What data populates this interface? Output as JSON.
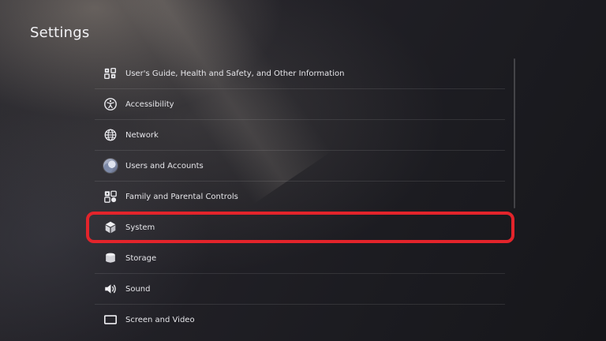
{
  "page": {
    "title": "Settings"
  },
  "settings": {
    "items": [
      {
        "label": "User's Guide, Health and Safety, and Other Information",
        "icon": "guide-icon"
      },
      {
        "label": "Accessibility",
        "icon": "accessibility-icon"
      },
      {
        "label": "Network",
        "icon": "globe-icon"
      },
      {
        "label": "Users and Accounts",
        "icon": "avatar"
      },
      {
        "label": "Family and Parental Controls",
        "icon": "family-icon"
      },
      {
        "label": "System",
        "icon": "cube-icon"
      },
      {
        "label": "Storage",
        "icon": "storage-icon"
      },
      {
        "label": "Sound",
        "icon": "speaker-icon"
      },
      {
        "label": "Screen and Video",
        "icon": "screen-icon"
      }
    ],
    "highlighted_index": 5
  },
  "colors": {
    "highlight": "#e3242b",
    "text": "#e6e6ea"
  }
}
